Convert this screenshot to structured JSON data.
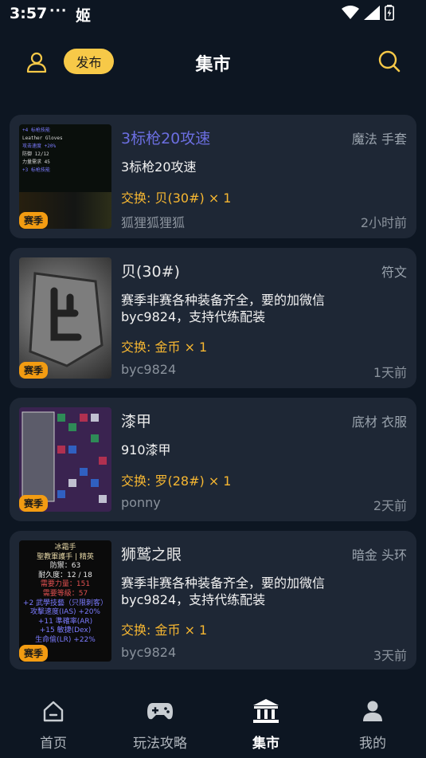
{
  "status": {
    "time": "3:57",
    "dots": "···",
    "app_glyph": "姬"
  },
  "header": {
    "publish_label": "发布",
    "title": "集市"
  },
  "listings": [
    {
      "title": "3标枪20攻速",
      "category": "魔法 手套",
      "description": "3标枪20攻速",
      "exchange": "交换: 贝(30#) × 1",
      "seller": "狐狸狐狸狐",
      "time": "2小时前",
      "badge": "赛季",
      "thumb_lines": [
        "+4 标枪技能",
        "Leather Gloves",
        "攻击速度 +20%",
        "防御 12/12",
        "力量需求 45",
        "+3 标枪技能"
      ]
    },
    {
      "title": "贝(30#)",
      "category": "符文",
      "description": "赛季非赛各种装备齐全，要的加微信byc9824，支持代练配装",
      "exchange": "交换: 金币 × 1",
      "seller": "byc9824",
      "time": "1天前",
      "badge": "赛季"
    },
    {
      "title": "漆甲",
      "category": "底材 衣服",
      "description": "910漆甲",
      "exchange": "交换: 罗(28#) × 1",
      "seller": "ponny",
      "time": "2天前",
      "badge": "赛季"
    },
    {
      "title": "狮鹫之眼",
      "category": "暗金 头环",
      "description": "赛季非赛各种装备齐全，要的加微信byc9824，支持代练配装",
      "exchange": "交换: 金币 × 1",
      "seller": "byc9824",
      "time": "3天前",
      "badge": "赛季",
      "thumb_lines": [
        "冰霜手",
        "聖教軍護手 | 精英",
        "防禦：63",
        "耐久度：12 / 18",
        "需要力量：151",
        "需要等級：57",
        "+2 武學技藝（只限刺客）",
        "攻擊速度(IAS) +20%",
        "+11 準確率(AR)",
        "+15 敏捷(Dex)",
        "生命偷(LR) +22%"
      ]
    }
  ],
  "tabs": [
    {
      "label": "首页",
      "icon": "home-icon"
    },
    {
      "label": "玩法攻略",
      "icon": "gamepad-icon"
    },
    {
      "label": "集市",
      "icon": "market-icon",
      "active": true
    },
    {
      "label": "我的",
      "icon": "profile-icon"
    }
  ],
  "colors": {
    "background": "#0d1622",
    "card": "#1e2735",
    "accent": "#f7c948",
    "exchange": "#f7b731",
    "badge": "#f39c12"
  }
}
